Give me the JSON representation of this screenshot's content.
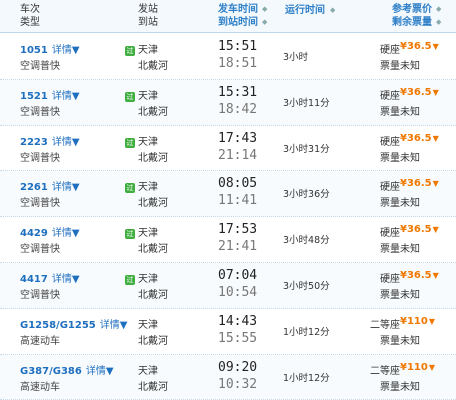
{
  "header": {
    "train_label": "车次",
    "type_label": "类型",
    "depart_label": "发站",
    "arrive_label": "到站",
    "depart_time_label": "发车时间",
    "arrive_time_label": "到站时间",
    "duration_label": "运行时间",
    "price_label": "参考票价",
    "remaining_label": "剩余票量"
  },
  "detail_label": "详情▼",
  "pass_badge": "过",
  "rows": [
    {
      "train": "1051",
      "type": "空调普快",
      "from": "天津",
      "to": "北戴河",
      "dep": "15:51",
      "arr": "18:51",
      "duration": "3小时",
      "seat": "硬座",
      "price": "¥36.5",
      "remaining": "票量未知",
      "pass": true
    },
    {
      "train": "1521",
      "type": "空调普快",
      "from": "天津",
      "to": "北戴河",
      "dep": "15:31",
      "arr": "18:42",
      "duration": "3小时11分",
      "seat": "硬座",
      "price": "¥36.5",
      "remaining": "票量未知",
      "pass": true
    },
    {
      "train": "2223",
      "type": "空调普快",
      "from": "天津",
      "to": "北戴河",
      "dep": "17:43",
      "arr": "21:14",
      "duration": "3小时31分",
      "seat": "硬座",
      "price": "¥36.5",
      "remaining": "票量未知",
      "pass": true
    },
    {
      "train": "2261",
      "type": "空调普快",
      "from": "天津",
      "to": "北戴河",
      "dep": "08:05",
      "arr": "11:41",
      "duration": "3小时36分",
      "seat": "硬座",
      "price": "¥36.5",
      "remaining": "票量未知",
      "pass": true
    },
    {
      "train": "4429",
      "type": "空调普快",
      "from": "天津",
      "to": "北戴河",
      "dep": "17:53",
      "arr": "21:41",
      "duration": "3小时48分",
      "seat": "硬座",
      "price": "¥36.5",
      "remaining": "票量未知",
      "pass": true
    },
    {
      "train": "4417",
      "type": "空调普快",
      "from": "天津",
      "to": "北戴河",
      "dep": "07:04",
      "arr": "10:54",
      "duration": "3小时50分",
      "seat": "硬座",
      "price": "¥36.5",
      "remaining": "票量未知",
      "pass": true
    },
    {
      "train": "G1258/G1255",
      "type": "高速动车",
      "from": "天津",
      "to": "北戴河",
      "dep": "14:43",
      "arr": "15:55",
      "duration": "1小时12分",
      "seat": "二等座",
      "price": "¥110",
      "remaining": "票量未知",
      "pass": false
    },
    {
      "train": "G387/G386",
      "type": "高速动车",
      "from": "天津",
      "to": "北戴河",
      "dep": "09:20",
      "arr": "10:32",
      "duration": "1小时12分",
      "seat": "二等座",
      "price": "¥110",
      "remaining": "票量未知",
      "pass": false
    }
  ],
  "colors": {
    "link": "#1f6fbf",
    "price": "#f07800",
    "header_blue": "#2f80c8",
    "badge": "#3fae3f"
  }
}
